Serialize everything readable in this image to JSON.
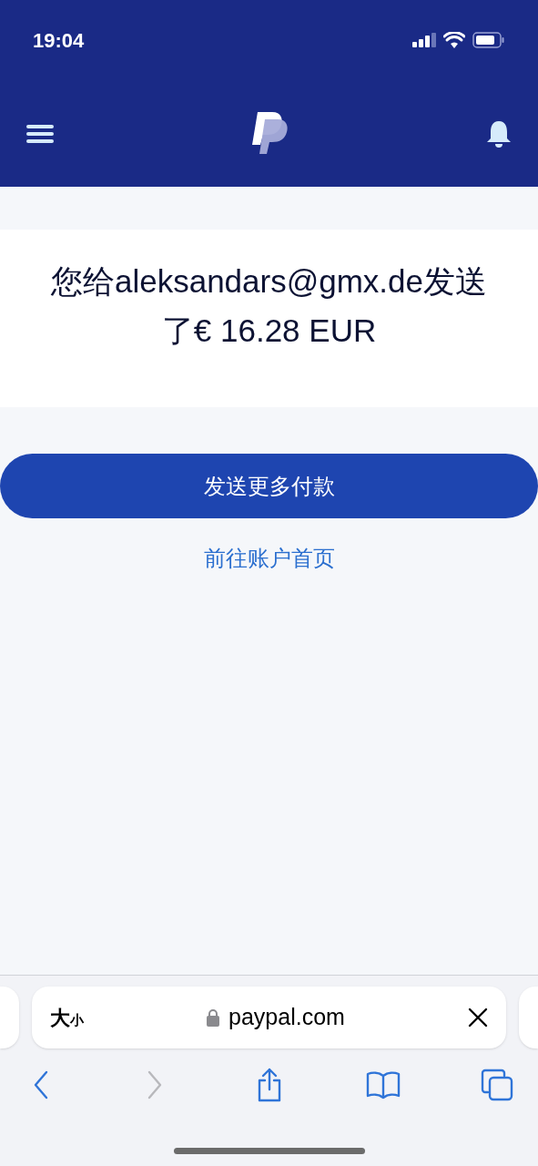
{
  "status_bar": {
    "time": "19:04"
  },
  "confirmation": {
    "message": "您给aleksandars@gmx.de发送了€ 16.28 EUR"
  },
  "actions": {
    "primary_button": "发送更多付款",
    "link": "前往账户首页"
  },
  "browser": {
    "text_size": {
      "large": "大",
      "small": "小"
    },
    "url": "paypal.com",
    "nav": [
      {
        "kind": "back",
        "disabled": false
      },
      {
        "kind": "forward",
        "disabled": true
      },
      {
        "kind": "share",
        "disabled": false
      },
      {
        "kind": "bookmarks",
        "disabled": false
      },
      {
        "kind": "tabs",
        "disabled": false
      }
    ]
  }
}
